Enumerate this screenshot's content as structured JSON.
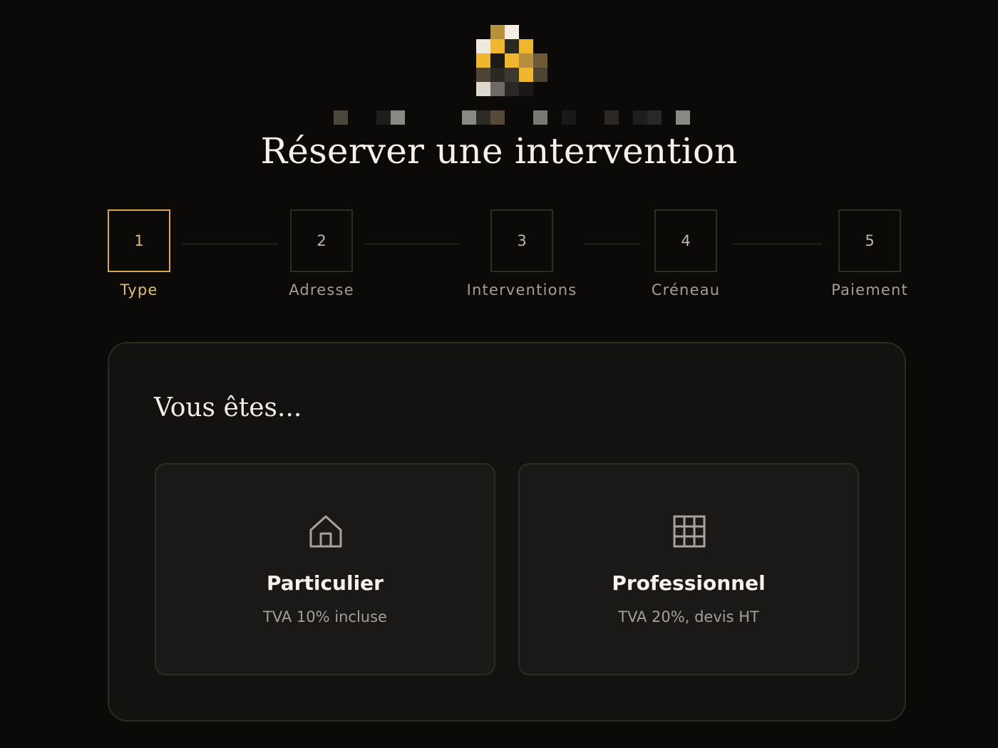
{
  "brand": {
    "logo_alt": "logo"
  },
  "header": {
    "title": "Réserver une intervention"
  },
  "stepper": {
    "steps": [
      {
        "number": "1",
        "label": "Type",
        "active": true
      },
      {
        "number": "2",
        "label": "Adresse",
        "active": false
      },
      {
        "number": "3",
        "label": "Interventions",
        "active": false
      },
      {
        "number": "4",
        "label": "Créneau",
        "active": false
      },
      {
        "number": "5",
        "label": "Paiement",
        "active": false
      }
    ]
  },
  "card": {
    "title": "Vous êtes...",
    "options": [
      {
        "title": "Particulier",
        "subtitle": "TVA 10% incluse",
        "icon": "house-icon"
      },
      {
        "title": "Professionnel",
        "subtitle": "TVA 20%, devis HT",
        "icon": "building-grid-icon"
      }
    ]
  },
  "colors": {
    "background": "#0b0a09",
    "card": "#131211",
    "option": "#1a1918",
    "accent": "#d6aa4c",
    "text": "#f3eee6",
    "muted": "#a39e96"
  }
}
